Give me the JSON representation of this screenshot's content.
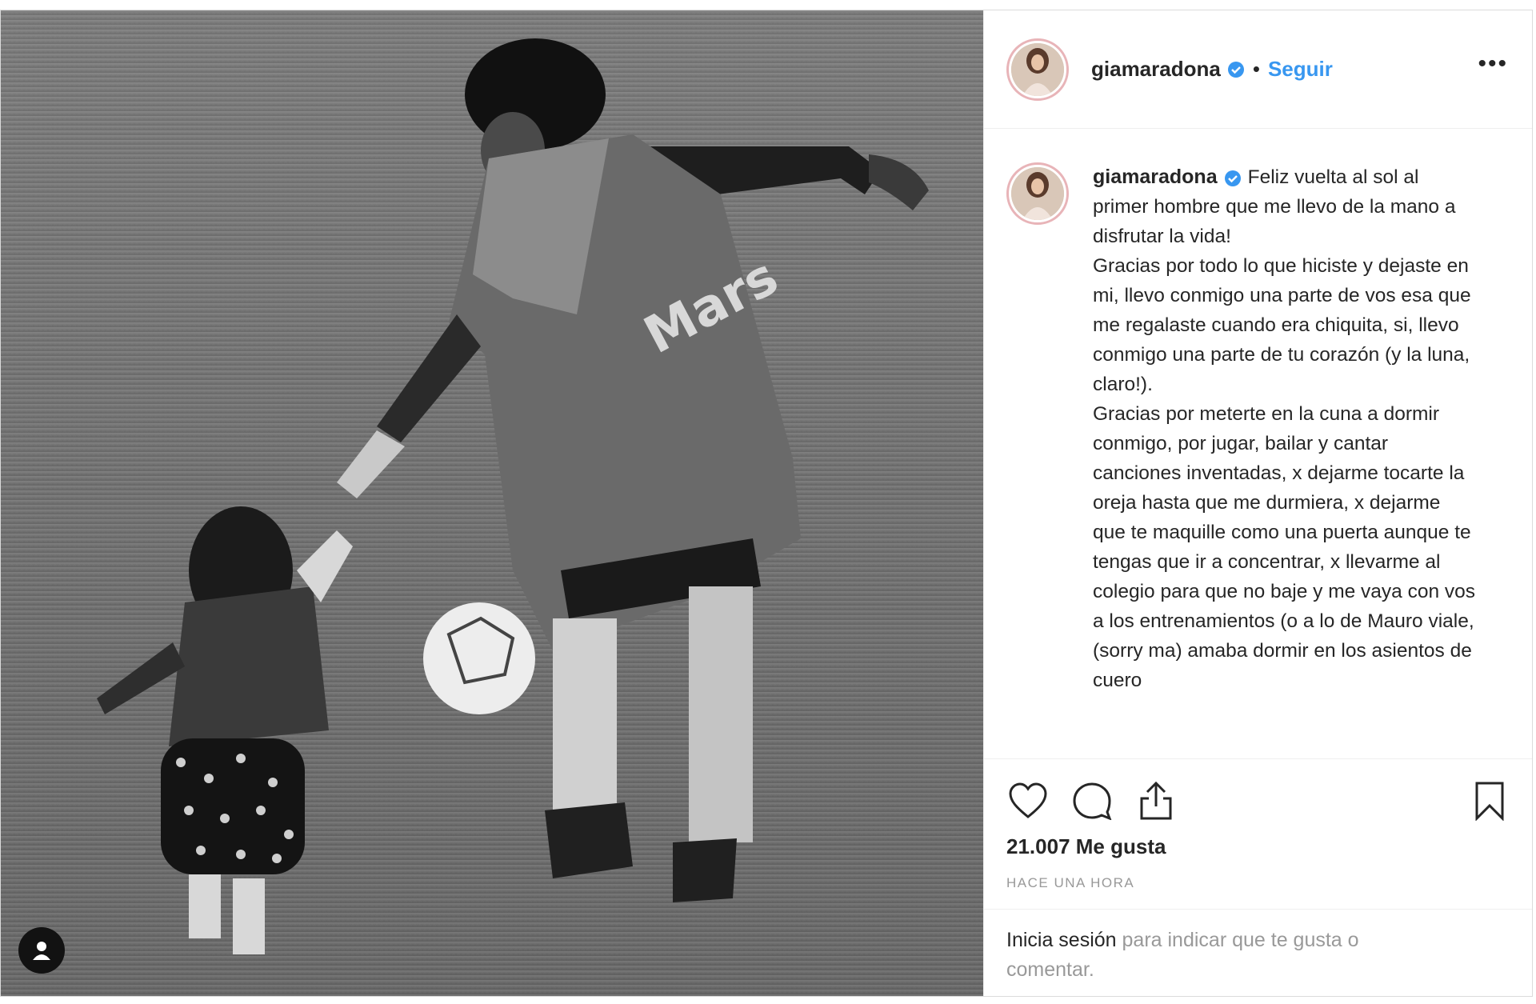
{
  "post": {
    "username": "giamaradona",
    "follow_label": "Seguir",
    "separator": "•",
    "more_label": "•••",
    "caption": "Feliz vuelta al sol al primer hombre que me llevo de la mano a disfrutar la vida!\nGracias por todo lo que hiciste y dejaste en mi, llevo conmigo una parte de vos esa que me regalaste cuando era chiquita, si, llevo conmigo una parte de tu corazón (y la luna, claro!).\nGracias por meterte en la cuna a dormir conmigo, por jugar, bailar y cantar canciones inventadas, x dejarme tocarte la oreja hasta que me durmiera, x dejarme que te maquille como una puerta aunque te tengas que ir a concentrar, x llevarme al colegio para que no baje y me vaya con vos a los entrenamientos (o a lo de Mauro viale, (sorry ma) amaba dormir en los asientos de cuero",
    "likes": "21.007 Me gusta",
    "time": "HACE UNA HORA",
    "login_link": "Inicia sesión",
    "login_rest": " para indicar que te gusta o comentar.",
    "photo_jacket_text": "Mars"
  },
  "icons": {
    "like": "heart-icon",
    "comment": "comment-icon",
    "share": "share-icon",
    "save": "bookmark-icon",
    "verified": "verified-badge-icon",
    "user_tag": "user-tag-icon"
  },
  "colors": {
    "link_blue": "#3897f0",
    "verified_blue": "#3897f0",
    "text": "#262626",
    "muted": "#999999",
    "avatar_ring": "#e8b4b8"
  }
}
